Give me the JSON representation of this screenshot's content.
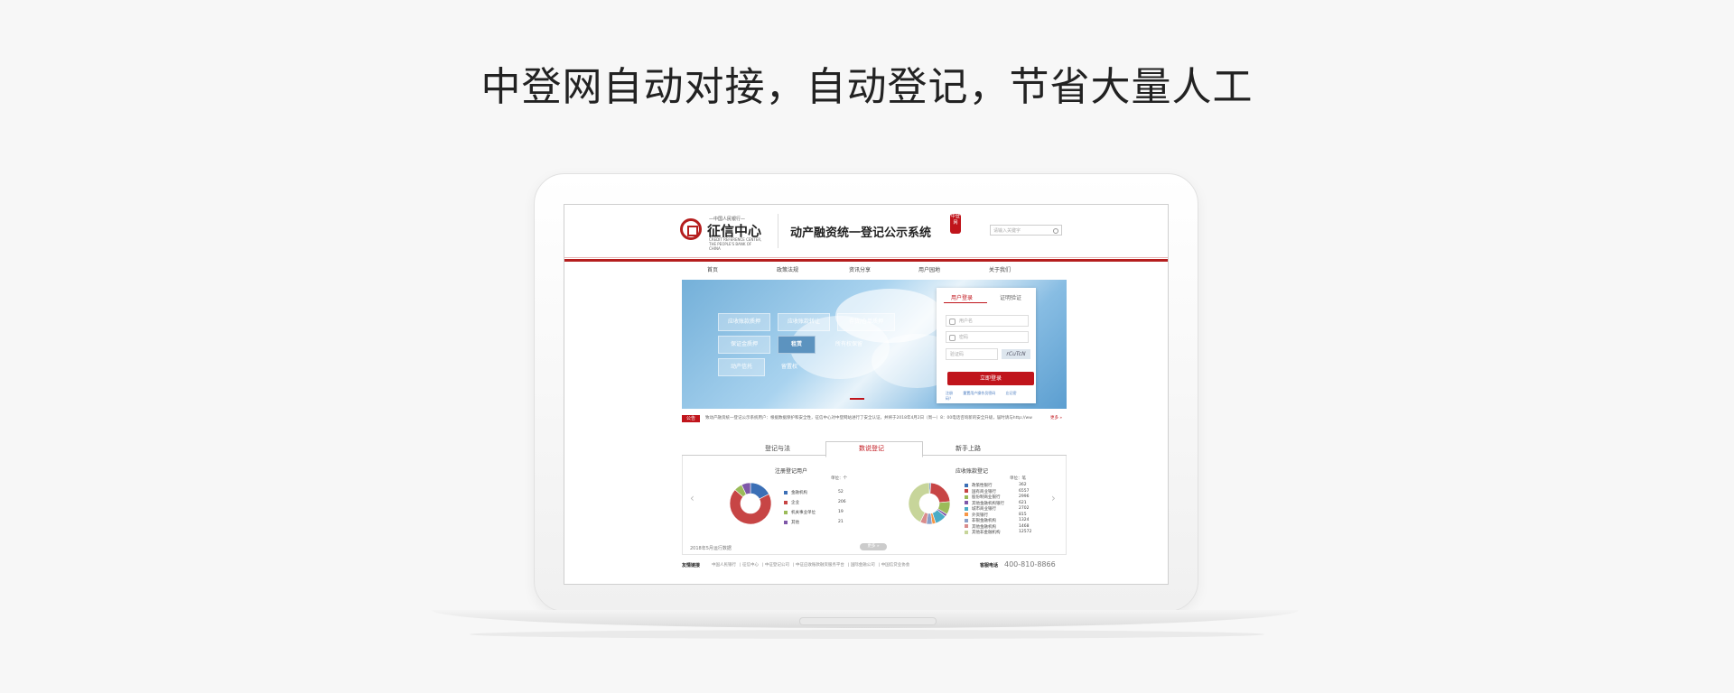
{
  "headline": "中登网自动对接，自动登记，节省大量人工",
  "site": {
    "logo_small": "—中国人民银行—",
    "logo_main": "征信中心",
    "logo_en": "CREDIT REFERENCE CENTER, THE PEOPLE'S BANK OF CHINA",
    "system_title": "动产融资统一登记公示系统",
    "stamp_text": "中登网",
    "search_placeholder": "请输入关键字"
  },
  "nav": [
    "首页",
    "政策法规",
    "资讯分享",
    "用户园地",
    "关于我们"
  ],
  "banner_tags": [
    "应收账款质押",
    "应收账款转让",
    "存货/仓单质押",
    "保证金质押",
    "租赁",
    "所有权保留",
    "动产信托",
    "留置权"
  ],
  "login": {
    "tab_user": "用户登录",
    "tab_cert": "证明验证",
    "username_placeholder": "用户名",
    "password_placeholder": "密码",
    "code_placeholder": "验证码",
    "captcha_text": "rCuTcN",
    "submit": "立即登录",
    "link_register": "注册",
    "link_forgot_holder": "重置用户操作员密码",
    "link_forgot": "忘记密码？"
  },
  "notice": {
    "badge": "公告",
    "text": "致动产融资统一登记公示系统用户：根据数据保护和安全性，征信中心对中登网站进行了安全认证，并将于2018年4月2日（周一）8：00电话咨询新的安全升级，届时请与http://ww",
    "more": "更多 »"
  },
  "tabs": [
    "登记与法",
    "数说登记",
    "新手上路"
  ],
  "stats": {
    "left": {
      "title": "注册登记用户",
      "unit": "单位：个",
      "items": [
        {
          "label": "金融机构",
          "value": "52",
          "color": "#3b6fb6"
        },
        {
          "label": "企业",
          "value": "206",
          "color": "#c74545"
        },
        {
          "label": "机关事业单位",
          "value": "19",
          "color": "#9bbb59"
        },
        {
          "label": "其他",
          "value": "21",
          "color": "#7e57a8"
        }
      ]
    },
    "right": {
      "title": "应收账款登记",
      "unit": "单位：笔",
      "items": [
        {
          "label": "政策性银行",
          "value": "362",
          "color": "#3b6fb6"
        },
        {
          "label": "国有商业银行",
          "value": "6557",
          "color": "#c74545"
        },
        {
          "label": "股份制商业银行",
          "value": "2996",
          "color": "#9bbb59"
        },
        {
          "label": "其他金融机构银行",
          "value": "621",
          "color": "#7e57a8"
        },
        {
          "label": "城市商业银行",
          "value": "2702",
          "color": "#4bacc6"
        },
        {
          "label": "外资银行",
          "value": "815",
          "color": "#f79646"
        },
        {
          "label": "非银金融机构",
          "value": "1324",
          "color": "#8aa0c8"
        },
        {
          "label": "其他金融机构",
          "value": "1468",
          "color": "#d98c8c"
        },
        {
          "label": "其他非金融机构",
          "value": "12572",
          "color": "#c7d59a"
        }
      ]
    },
    "footnote": "2018年5月运行数据",
    "more": "更多 »"
  },
  "footer": {
    "links_label": "友情链接",
    "links": [
      "中国人民银行",
      "征信中心",
      "中征登记公司",
      "中征应收账款融资服务平台",
      "国际金融公司",
      "中国信贷业协会"
    ],
    "hotline_label": "客服电话",
    "hotline": "400-810-8866"
  }
}
